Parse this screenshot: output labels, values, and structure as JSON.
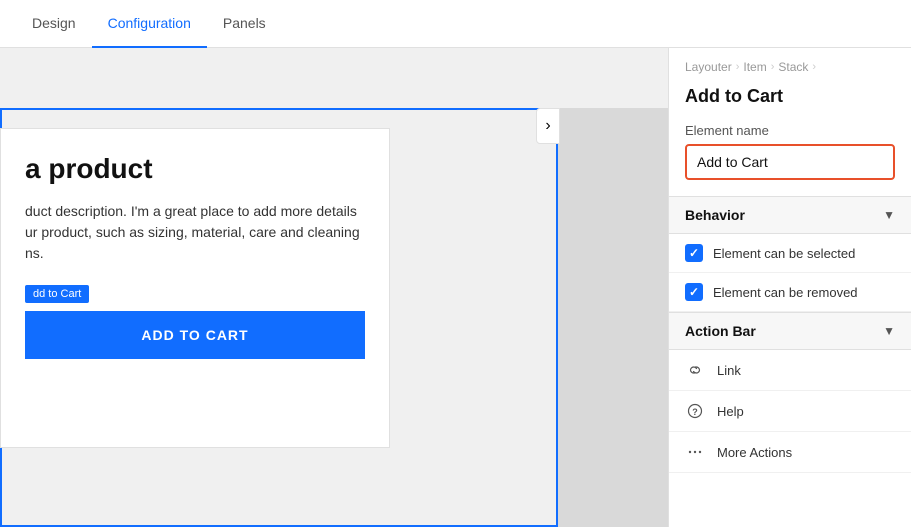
{
  "tabs": {
    "items": [
      {
        "id": "design",
        "label": "Design",
        "active": false
      },
      {
        "id": "configuration",
        "label": "Configuration",
        "active": true
      },
      {
        "id": "panels",
        "label": "Panels",
        "active": false
      }
    ]
  },
  "breadcrumb": {
    "items": [
      "Layouter",
      "Item",
      "Stack"
    ]
  },
  "config": {
    "title": "Add to Cart",
    "element_name_label": "Element name",
    "element_name_value": "Add to Cart"
  },
  "behavior": {
    "section_title": "Behavior",
    "element_can_be_selected": "Element can be selected",
    "element_can_be_removed": "Element can be removed"
  },
  "action_bar": {
    "section_title": "Action Bar",
    "items": [
      {
        "id": "link",
        "icon": "🔗",
        "label": "Link"
      },
      {
        "id": "help",
        "icon": "?",
        "label": "Help"
      },
      {
        "id": "more",
        "icon": "•••",
        "label": "More Actions"
      }
    ]
  },
  "preview": {
    "product_title": "a product",
    "product_desc": "duct description. I'm a great place to add more details ur product, such as sizing, material, care and cleaning ns.",
    "add_to_cart_tag": "dd to Cart",
    "add_to_cart_button": "ADD TO CART"
  },
  "collapse_icon": "›"
}
